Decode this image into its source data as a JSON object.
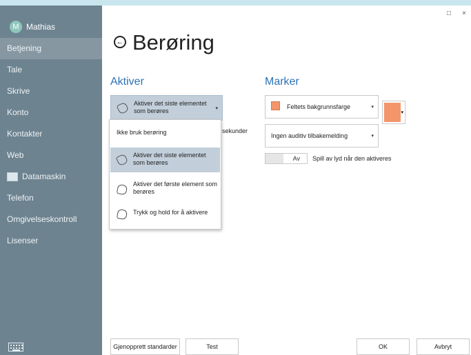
{
  "user": {
    "initial": "M",
    "name": "Mathias"
  },
  "nav": [
    {
      "label": "Betjening"
    },
    {
      "label": "Tale"
    },
    {
      "label": "Skrive"
    },
    {
      "label": "Konto"
    },
    {
      "label": "Kontakter"
    },
    {
      "label": "Web"
    },
    {
      "label": "Datamaskin",
      "icon": "monitor-icon"
    },
    {
      "label": "Telefon"
    },
    {
      "label": "Omgivelseskontroll"
    },
    {
      "label": "Lisenser"
    }
  ],
  "window": {
    "maximize": "□",
    "close": "×"
  },
  "page": {
    "back_icon": "←",
    "title": "Berøring"
  },
  "activate": {
    "heading": "Aktiver",
    "selected": "Aktiver det siste elementet som berøres",
    "selected_line1": "Aktiver det siste elementet",
    "selected_line2": "som berøres",
    "seconds_label": "sekunder",
    "options": [
      {
        "label": "Ikke bruk berøring"
      },
      {
        "line1": "Aktiver det siste elementet",
        "line2": "som berøres"
      },
      {
        "line1": "Aktiver det første element som",
        "line2": "berøres"
      },
      {
        "label": "Trykk og hold for å aktivere"
      }
    ]
  },
  "mark": {
    "heading": "Marker",
    "color_mode": "Feltets bakgrunnsfarge",
    "color": "#f4956b",
    "audio": "Ingen auditiv tilbakemelding",
    "toggle_state": "Av",
    "toggle_label": "Spill av lyd når den aktiveres"
  },
  "buttons": {
    "reset": "Gjenopprett standarder",
    "test": "Test",
    "ok": "OK",
    "cancel": "Avbryt"
  }
}
